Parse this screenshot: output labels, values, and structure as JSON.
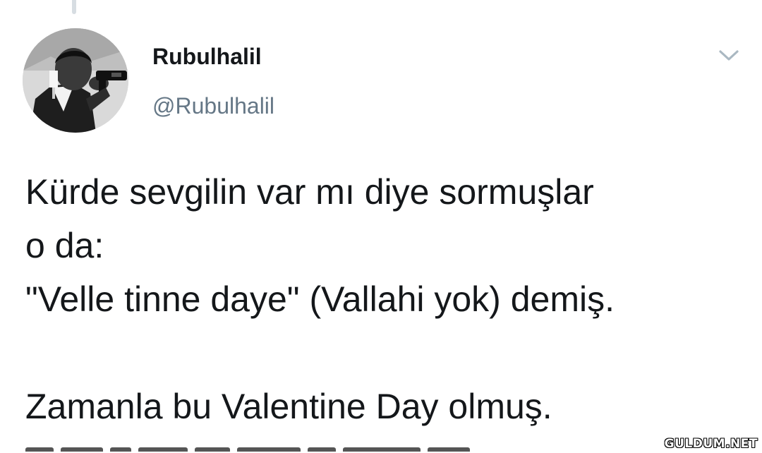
{
  "tweet": {
    "author": {
      "display_name": "Rubulhalil",
      "handle": "@Rubulhalil",
      "avatar_icon": "profile-photo"
    },
    "menu_icon": "chevron-down-icon",
    "text_lines": [
      "Kürde sevgilin var mı diye sormuşlar",
      "o da:",
      "\"Velle tinne daye\" (Vallahi yok) demiş.",
      "",
      "Zamanla bu Valentine Day olmuş."
    ]
  },
  "watermark": "GULDUM.NET",
  "colors": {
    "text": "#14171a",
    "secondary": "#657786",
    "caret": "#aab8c2",
    "thread_line": "#d7dde2"
  }
}
